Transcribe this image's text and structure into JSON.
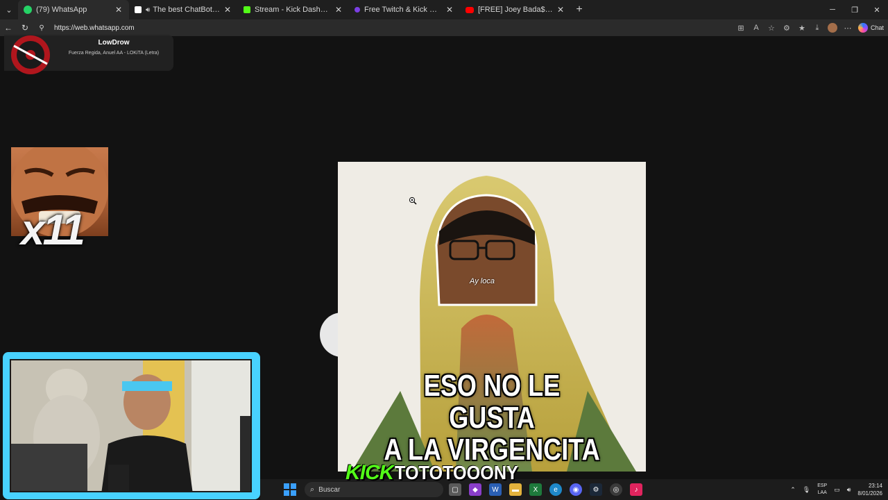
{
  "browser": {
    "tabs": [
      {
        "title": "(79) WhatsApp",
        "favicon_color": "#25d366",
        "active": true
      },
      {
        "title": "The best ChatBot and Widget",
        "favicon_color": "#ffffff",
        "active": false
      },
      {
        "title": "Stream - Kick Dashboard",
        "favicon_color": "#53fc18",
        "active": false
      },
      {
        "title": "Free Twitch & Kick Viewers - Try 1",
        "favicon_color": "#7b3fe4",
        "active": false
      },
      {
        "title": "[FREE] Joey Bada$$ x The Alchemi",
        "favicon_color": "#ff0000",
        "active": false
      }
    ],
    "url": "https://web.whatsapp.com",
    "chat_label": "Chat"
  },
  "now_playing": {
    "artist": "LowDrow",
    "track": "Fuerza Regida, Anuel AA - LOKiTA (Letra)"
  },
  "emote": {
    "count": "x11"
  },
  "meme": {
    "label": "Ay loca",
    "caption_lines": [
      "ESO NO LE",
      "GUSTA",
      "A LA VIRGENCITA"
    ]
  },
  "stream_tag": {
    "platform": "KICK",
    "username": "TOTOTOOONY"
  },
  "taskbar": {
    "search_placeholder": "Buscar",
    "lang_top": "ESP",
    "lang_bottom": "LAA",
    "time": "23:14",
    "date": "8/01/2026"
  },
  "colors": {
    "kick_green": "#53fc18",
    "cam_border": "#48d2ff"
  }
}
